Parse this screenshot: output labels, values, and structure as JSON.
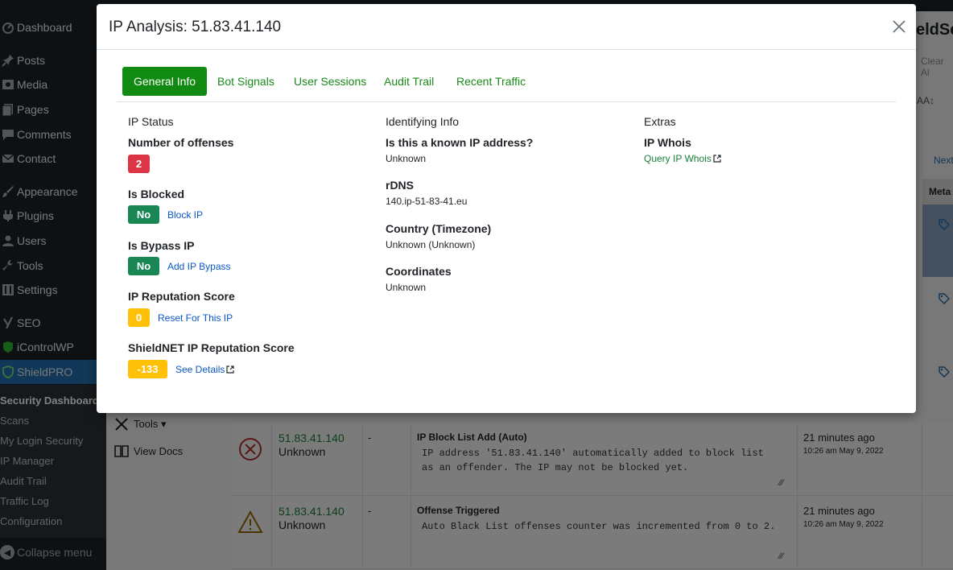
{
  "sidebar": {
    "items": [
      {
        "label": "Dashboard",
        "icon": "dashboard-icon"
      },
      {
        "label": "Posts",
        "icon": "pin-icon"
      },
      {
        "label": "Media",
        "icon": "media-icon"
      },
      {
        "label": "Pages",
        "icon": "pages-icon"
      },
      {
        "label": "Comments",
        "icon": "comments-icon"
      },
      {
        "label": "Contact",
        "icon": "mail-icon"
      },
      {
        "label": "Appearance",
        "icon": "brush-icon"
      },
      {
        "label": "Plugins",
        "icon": "plugin-icon"
      },
      {
        "label": "Users",
        "icon": "users-icon"
      },
      {
        "label": "Tools",
        "icon": "wrench-icon"
      },
      {
        "label": "Settings",
        "icon": "settings-icon"
      },
      {
        "label": "SEO",
        "icon": "yoast-icon"
      },
      {
        "label": "iControlWP",
        "icon": "shield-icon"
      },
      {
        "label": "ShieldPRO",
        "icon": "shield-icon"
      }
    ],
    "submenu": [
      "Security Dashboard",
      "Scans",
      "My Login Security",
      "IP Manager",
      "Audit Trail",
      "Traffic Log",
      "Configuration"
    ],
    "collapse_label": "Collapse menu"
  },
  "background": {
    "title_fragment": "eldSec",
    "clear_fragment": "Clear Al",
    "aa_fragment": "AA↕",
    "next_fragment": "Next",
    "meta_header": "Meta",
    "tools_label": "Tools ▾",
    "docs_label": "View Docs",
    "rows": [
      {
        "ip": "51.83.41.140",
        "ip_sub": "Unknown",
        "dash": "-",
        "event": "IP Block List Add (Auto)",
        "message": "IP address '51.83.41.140' automatically added to block list as an offender. The IP may not be blocked yet.",
        "when": "21 minutes ago",
        "date": "10:26 am May 9, 2022",
        "icon": "blocked-circle-icon"
      },
      {
        "ip": "51.83.41.140",
        "ip_sub": "Unknown",
        "dash": "-",
        "event": "Offense Triggered",
        "message": "Auto Black List offenses counter was incremented from 0 to 2.",
        "when": "21 minutes ago",
        "date": "10:26 am May 9, 2022",
        "icon": "warning-triangle-icon"
      }
    ]
  },
  "modal": {
    "title": "IP Analysis: 51.83.41.140",
    "tabs": [
      "General Info",
      "Bot Signals",
      "User Sessions",
      "Audit Trail",
      "Recent Traffic"
    ],
    "ip_status": {
      "heading": "IP Status",
      "offenses_label": "Number of offenses",
      "offenses_value": "2",
      "blocked_label": "Is Blocked",
      "blocked_value": "No",
      "blocked_link": "Block IP",
      "bypass_label": "Is Bypass IP",
      "bypass_value": "No",
      "bypass_link": "Add IP Bypass",
      "reputation_label": "IP Reputation Score",
      "reputation_value": "0",
      "reputation_link": "Reset For This IP",
      "shieldnet_label": "ShieldNET IP Reputation Score",
      "shieldnet_value": "-133",
      "shieldnet_link": "See Details"
    },
    "identifying": {
      "heading": "Identifying Info",
      "known_label": "Is this a known IP address?",
      "known_value": "Unknown",
      "rdns_label": "rDNS",
      "rdns_value": "140.ip-51-83-41.eu",
      "country_label": "Country (Timezone)",
      "country_value": "Unknown (Unknown)",
      "coords_label": "Coordinates",
      "coords_value": "Unknown"
    },
    "extras": {
      "heading": "Extras",
      "whois_label": "IP Whois",
      "whois_link": "Query IP Whois"
    }
  },
  "colors": {
    "wp_sidebar": "#1d2327",
    "wp_active": "#2271b1",
    "tab_active": "#118a11",
    "badge_red": "#dc3545",
    "badge_green": "#198754",
    "badge_yellow": "#ffc107",
    "link_blue": "#0a58ca"
  }
}
